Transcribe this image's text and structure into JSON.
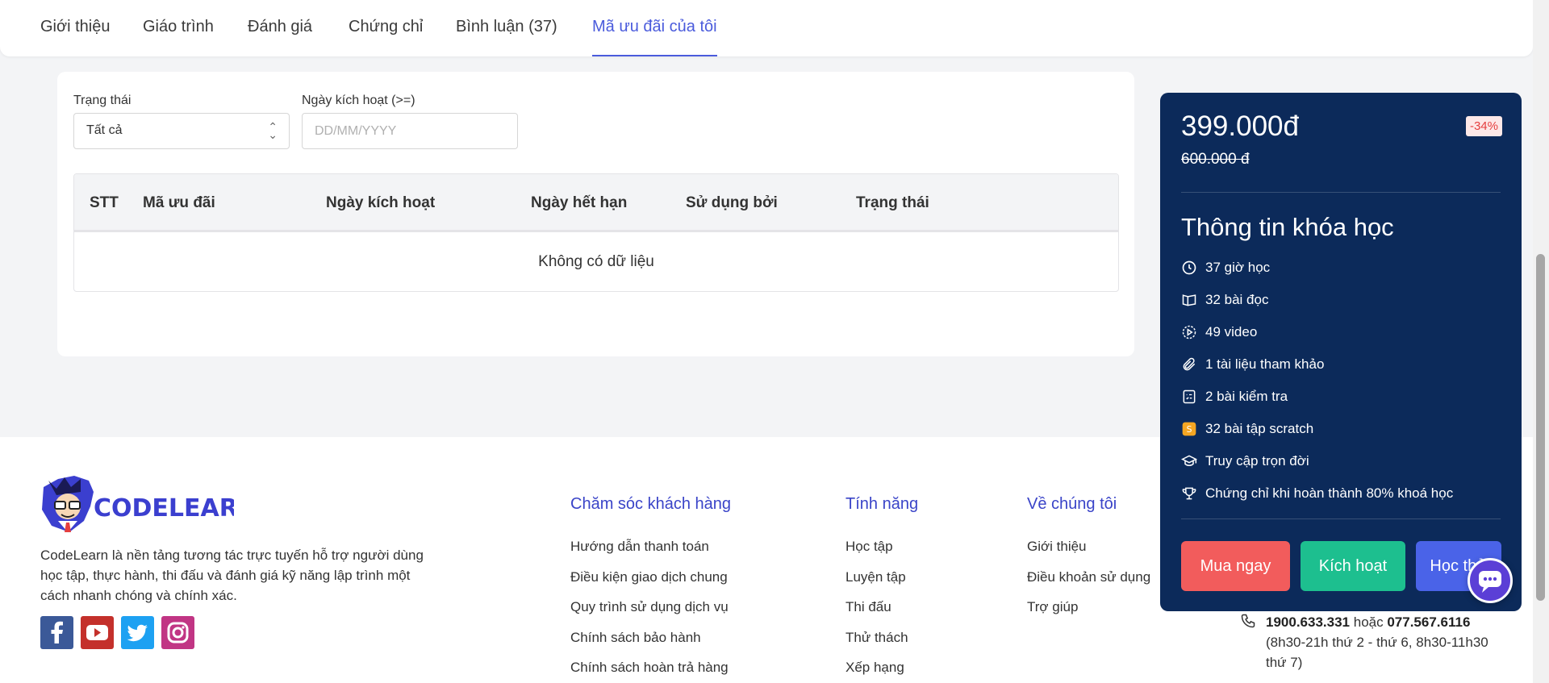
{
  "tabs": [
    {
      "label": "Giới thiệu"
    },
    {
      "label": "Giáo trình"
    },
    {
      "label": "Đánh giá"
    },
    {
      "label": "Chứng chỉ"
    },
    {
      "label": "Bình luận (37)"
    },
    {
      "label": "Mã ưu đãi của tôi",
      "active": true
    }
  ],
  "filters": {
    "status_label": "Trạng thái",
    "status_value": "Tất cả",
    "date_label": "Ngày kích hoạt (>=)",
    "date_placeholder": "DD/MM/YYYY"
  },
  "table": {
    "headers": [
      "STT",
      "Mã ưu đãi",
      "Ngày kích hoạt",
      "Ngày hết hạn",
      "Sử dụng bởi",
      "Trạng thái"
    ],
    "empty_text": "Không có dữ liệu"
  },
  "course": {
    "price": "399.000đ",
    "old_price": "600.000 đ",
    "discount": "-34%",
    "info_title": "Thông tin khóa học",
    "items": [
      {
        "icon": "clock-icon",
        "text": "37 giờ học"
      },
      {
        "icon": "book-icon",
        "text": "32 bài đọc"
      },
      {
        "icon": "video-icon",
        "text": "49 video"
      },
      {
        "icon": "paperclip-icon",
        "text": "1 tài liệu tham khảo"
      },
      {
        "icon": "quiz-icon",
        "text": "2 bài kiểm tra"
      },
      {
        "icon": "scratch-icon",
        "text": "32 bài tập scratch"
      },
      {
        "icon": "graduation-cap-icon",
        "text": "Truy cập trọn đời"
      },
      {
        "icon": "trophy-icon",
        "text": "Chứng chỉ khi hoàn thành 80% khoá học"
      }
    ],
    "buttons": {
      "buy": "Mua ngay",
      "activate": "Kích hoạt",
      "trial": "Học thử"
    }
  },
  "footer": {
    "logo_text": "CODELEARN",
    "description": "CodeLearn là nền tảng tương tác trực tuyến hỗ trợ người dùng học tập, thực hành, thi đấu và đánh giá kỹ năng lập trình một cách nhanh chóng và chính xác.",
    "columns": [
      {
        "title": "Chăm sóc khách hàng",
        "links": [
          "Hướng dẫn thanh toán",
          "Điều kiện giao dịch chung",
          "Quy trình sử dụng dịch vụ",
          "Chính sách bảo hành",
          "Chính sách hoàn trả hàng"
        ]
      },
      {
        "title": "Tính năng",
        "links": [
          "Học tập",
          "Luyện tập",
          "Thi đấu",
          "Thử thách",
          "Xếp hạng"
        ]
      },
      {
        "title": "Về chúng tôi",
        "links": [
          "Giới thiệu",
          "Điều khoản sử dụng",
          "Trợ giúp"
        ]
      }
    ],
    "phone1": "1900.633.331",
    "phone_or": "hoặc",
    "phone2": "077.567.6116",
    "hours": "(8h30-21h thứ 2 - thứ 6, 8h30-11h30 thứ 7)"
  },
  "colors": {
    "accent": "#4a5bdc",
    "card_bg": "#0c2a5a",
    "buy": "#f25c5c",
    "activate": "#1dbf8f",
    "trial": "#4a63e8"
  }
}
